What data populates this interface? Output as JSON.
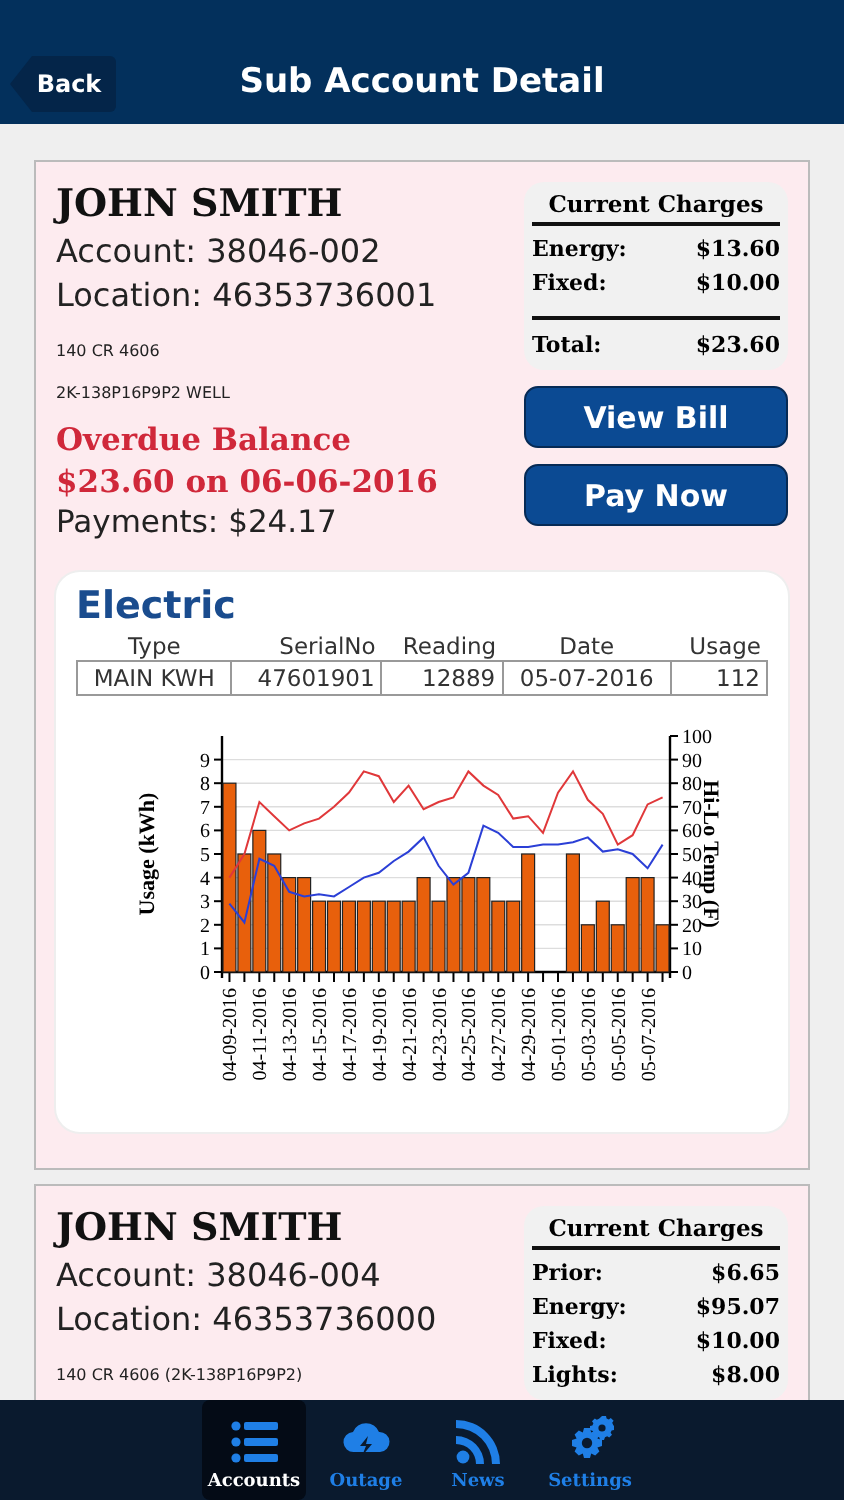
{
  "header": {
    "back": "Back",
    "title": "Sub Account Detail"
  },
  "accounts": [
    {
      "name": "JOHN SMITH",
      "account": "Account: 38046-002",
      "location": "Location: 46353736001",
      "address_lines": [
        "140 CR 4606",
        "2K-138P16P9P2 WELL"
      ],
      "overdue": [
        "Overdue Balance",
        "$23.60 on 06-06-2016"
      ],
      "payments": "Payments: $24.17",
      "charges": {
        "title": "Current Charges",
        "rows": [
          {
            "label": "Energy:",
            "amount": "$13.60"
          },
          {
            "label": "Fixed:",
            "amount": "$10.00"
          }
        ],
        "total": {
          "label": "Total:",
          "amount": "$23.60"
        }
      },
      "buttons": [
        "View Bill",
        "Pay Now"
      ],
      "meter": {
        "title": "Electric",
        "columns": [
          "Type",
          "SerialNo",
          "Reading",
          "Date",
          "Usage"
        ],
        "row": [
          "MAIN KWH",
          "47601901",
          "12889",
          "05-07-2016",
          "112"
        ],
        "chart_data": {
          "type": "bar",
          "ylabel": "Usage (kWh)",
          "y2label": "Hi-Lo Temp (F)",
          "grid": true,
          "categories": [
            "04-09-2016",
            null,
            "04-11-2016",
            null,
            "04-13-2016",
            null,
            "04-15-2016",
            null,
            "04-17-2016",
            null,
            "04-19-2016",
            null,
            "04-21-2016",
            null,
            "04-23-2016",
            null,
            "04-25-2016",
            null,
            "04-27-2016",
            null,
            "04-29-2016",
            null,
            "05-01-2016",
            null,
            "05-03-2016",
            null,
            "05-05-2016",
            null,
            "05-07-2016",
            null
          ],
          "series": [
            {
              "color": "#e8600c",
              "values": [
                8,
                5,
                6,
                5,
                4,
                4,
                3,
                3,
                3,
                3,
                3,
                3,
                3,
                4,
                3,
                4,
                4,
                4,
                3,
                3,
                5,
                null,
                null,
                5,
                2,
                3,
                2,
                4,
                4,
                2
              ]
            },
            {
              "type": "line",
              "axis": "y2",
              "color": "#e0383a",
              "values": [
                40,
                50,
                72,
                66,
                60,
                63,
                65,
                70,
                76,
                85,
                83,
                72,
                79,
                69,
                72,
                74,
                85,
                79,
                75,
                65,
                66,
                59,
                76,
                85,
                73,
                67,
                54,
                58,
                71,
                74
              ]
            },
            {
              "type": "line",
              "axis": "y2",
              "color": "#2b3fd6",
              "values": [
                29,
                21,
                48,
                45,
                34,
                32,
                33,
                32,
                36,
                40,
                42,
                47,
                51,
                57,
                45,
                37,
                42,
                62,
                59,
                53,
                53,
                54,
                54,
                55,
                57,
                51,
                52,
                50,
                44,
                54
              ]
            }
          ],
          "ylim": [
            0,
            10
          ],
          "yticks": [
            0,
            1,
            2,
            3,
            4,
            5,
            6,
            7,
            8,
            9
          ],
          "y2lim": [
            0,
            100
          ],
          "y2ticks": [
            0,
            10,
            20,
            30,
            40,
            50,
            60,
            70,
            80,
            90,
            100
          ]
        }
      }
    },
    {
      "name": "JOHN SMITH",
      "account": "Account: 38046-004",
      "location": "Location: 46353736000",
      "address_lines": [
        "140 CR 4606 (2K-138P16P9P2)"
      ],
      "charges": {
        "title": "Current Charges",
        "rows": [
          {
            "label": "Prior:",
            "amount": "$6.65"
          },
          {
            "label": "Energy:",
            "amount": "$95.07"
          },
          {
            "label": "Fixed:",
            "amount": "$10.00"
          },
          {
            "label": "Lights:",
            "amount": "$8.00"
          }
        ]
      }
    }
  ],
  "tabs": [
    {
      "label": "Accounts",
      "selected": true
    },
    {
      "label": "Outage",
      "selected": false
    },
    {
      "label": "News",
      "selected": false
    },
    {
      "label": "Settings",
      "selected": false
    }
  ]
}
